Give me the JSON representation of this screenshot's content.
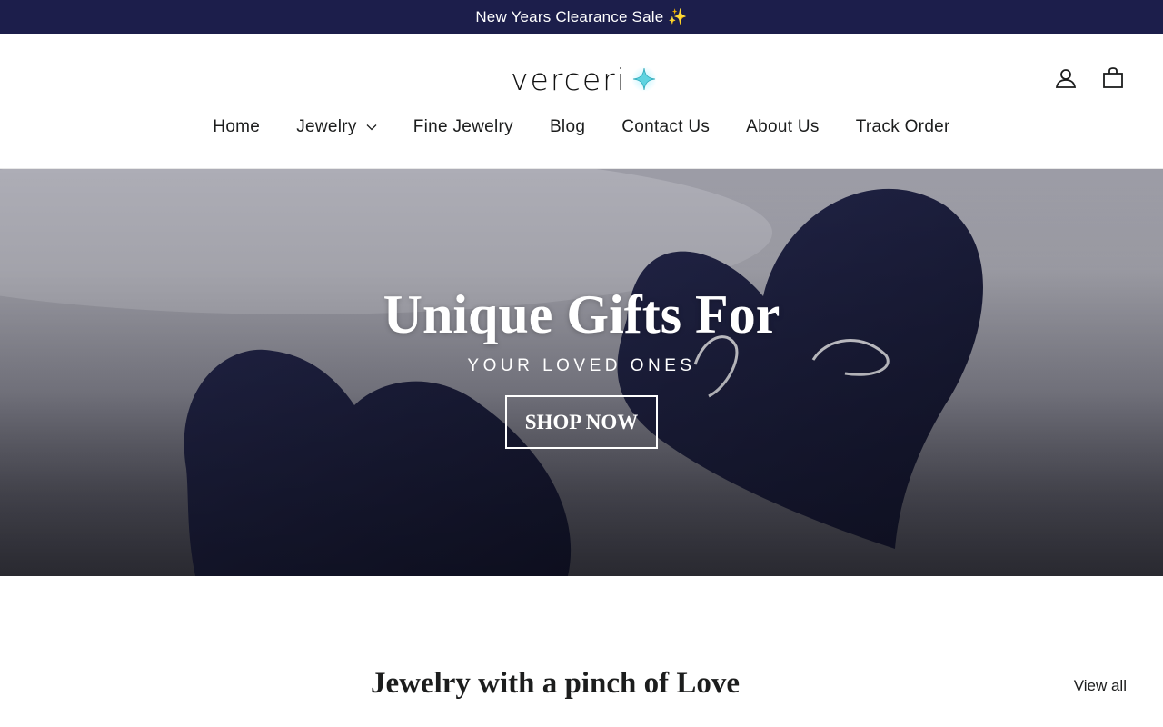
{
  "announcement": {
    "text": "New Years Clearance Sale ✨"
  },
  "header": {
    "logo_text": "verceri",
    "logo_icon": "sparkle-icon",
    "icons": [
      "account-icon",
      "cart-icon"
    ]
  },
  "nav": {
    "items": [
      {
        "label": "Home"
      },
      {
        "label": "Jewelry",
        "has_dropdown": true
      },
      {
        "label": "Fine Jewelry"
      },
      {
        "label": "Blog"
      },
      {
        "label": "Contact Us"
      },
      {
        "label": "About Us"
      },
      {
        "label": "Track Order"
      }
    ]
  },
  "hero": {
    "title": "Unique Gifts For",
    "subtitle": "YOUR LOVED ONES",
    "button_label": "SHOP NOW"
  },
  "featured": {
    "title": "Jewelry with a pinch of Love",
    "view_all_label": "View all"
  },
  "colors": {
    "announcement_bg": "#1c1e4b",
    "text": "#1c1d1d",
    "accent_star": "#5fd3e0"
  }
}
